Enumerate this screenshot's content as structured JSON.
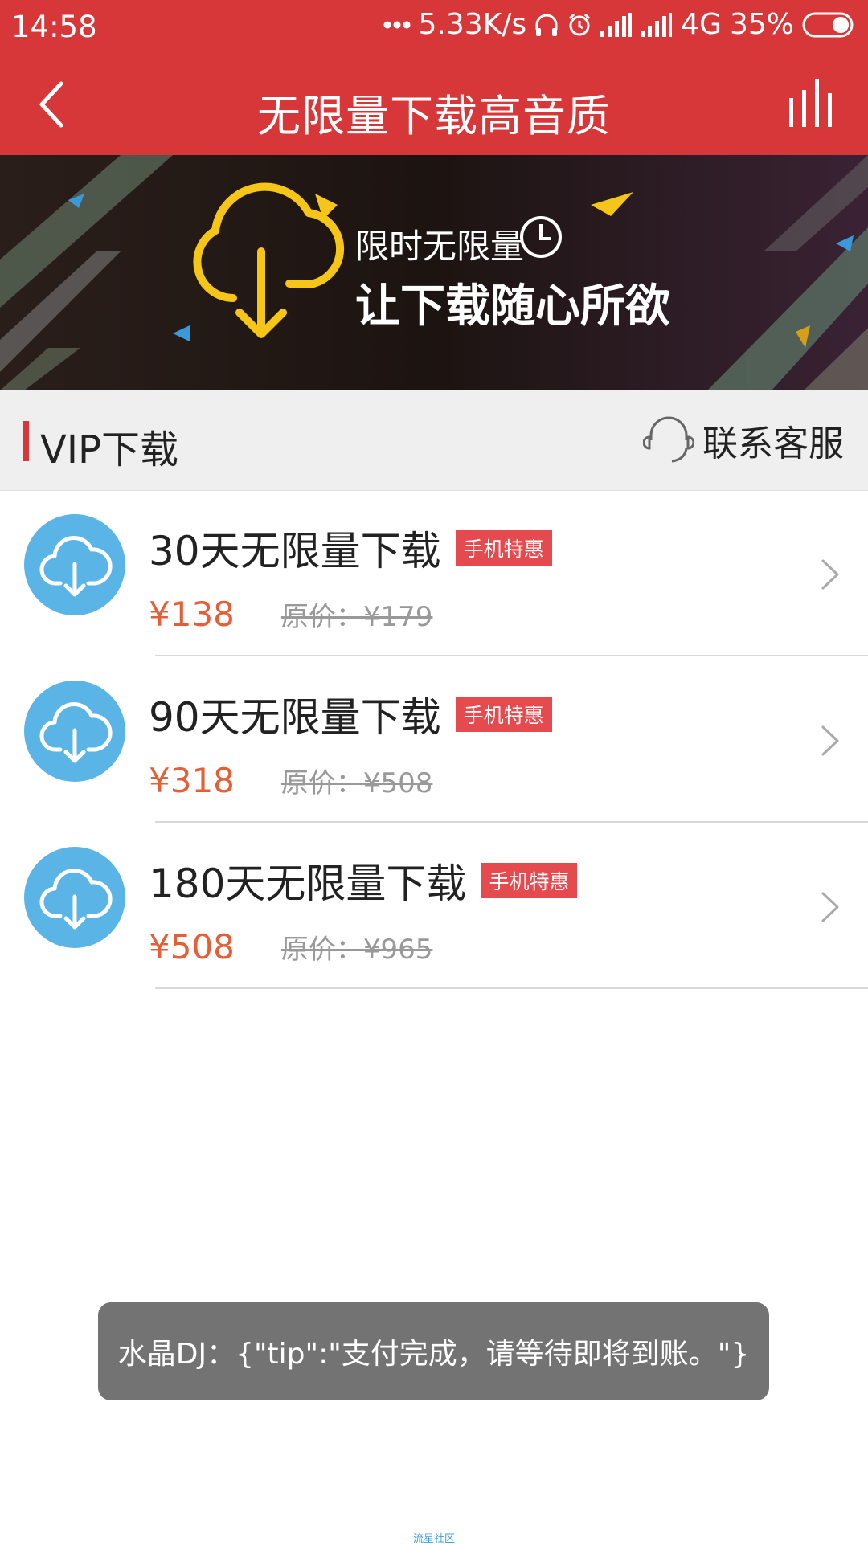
{
  "status_bar": {
    "time": "14:58",
    "network_speed": "5.33K/s",
    "network_type": "4G",
    "battery": "35%"
  },
  "header": {
    "title": "无限量下载高音质",
    "back_icon": "chevron-left-icon",
    "chart_icon": "equalizer-bars-icon"
  },
  "banner": {
    "line1": "限时无限量",
    "line2": "让下载随心所欲"
  },
  "section": {
    "title": "VIP下载",
    "contact_label": "联系客服",
    "contact_icon": "headset-icon"
  },
  "plans": [
    {
      "name": "30天无限量下载",
      "badge": "手机特惠",
      "price": "¥138",
      "original": "原价：¥179"
    },
    {
      "name": "90天无限量下载",
      "badge": "手机特惠",
      "price": "¥318",
      "original": "原价：¥508"
    },
    {
      "name": "180天无限量下载",
      "badge": "手机特惠",
      "price": "¥508",
      "original": "原价：¥965"
    }
  ],
  "toast": {
    "message": "水晶DJ：{\"tip\":\"支付完成，请等待即将到账。\"}"
  },
  "watermark": "流星社区",
  "colors": {
    "brand_red": "#d8373a",
    "price_orange": "#e55e35",
    "icon_blue": "#5ab5e6"
  }
}
